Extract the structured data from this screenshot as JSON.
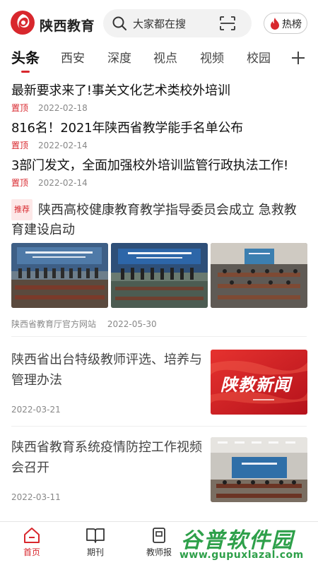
{
  "header": {
    "app_title": "陕西教育",
    "search_placeholder": "大家都在搜",
    "hot_label": "热榜"
  },
  "tabs": [
    {
      "label": "头条",
      "active": true
    },
    {
      "label": "西安"
    },
    {
      "label": "深度"
    },
    {
      "label": "视点"
    },
    {
      "label": "视频"
    },
    {
      "label": "校园"
    }
  ],
  "pinned": [
    {
      "title": "最新要求来了!事关文化艺术类校外培训",
      "tag": "置顶",
      "date": "2022-02-18"
    },
    {
      "title": "816名！2021年陕西省教学能手名单公布",
      "tag": "置顶",
      "date": "2022-02-14"
    },
    {
      "title": "3部门发文，全面加强校外培训监管行政执法工作!",
      "tag": "置顶",
      "date": "2022-02-14"
    }
  ],
  "recommended": {
    "tag": "推荐",
    "title": "陕西高校健康教育教学指导委员会成立 急救教育建设启动",
    "source": "陕西省教育厅官方网站",
    "date": "2022-05-30"
  },
  "news": [
    {
      "title": "陕西省出台特级教师评选、培养与管理办法",
      "date": "2022-03-21",
      "thumb_text": "陕教新闻"
    },
    {
      "title": "陕西省教育系统疫情防控工作视频会召开",
      "date": "2022-03-11"
    }
  ],
  "bottom_nav": [
    {
      "label": "首页",
      "active": true
    },
    {
      "label": "期刊"
    },
    {
      "label": "教师报"
    }
  ],
  "watermark": {
    "text": "谷普软件园",
    "url": "www.gupuxlazal.com"
  },
  "colors": {
    "accent": "#d8272d",
    "watermark": "#2ea04a"
  }
}
